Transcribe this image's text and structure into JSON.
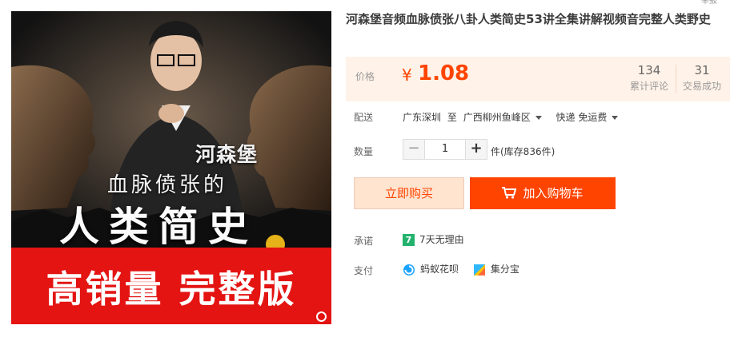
{
  "product_image": {
    "host": "河森堡",
    "subtitle": "血脉偾张的",
    "book_title": "人类简史",
    "banner": "高销量 完整版"
  },
  "product": {
    "title": "河森堡音频血脉偾张八卦人类简史53讲全集讲解视频音完整人类野史",
    "corner_cut_text": "举报"
  },
  "price": {
    "label": "价格",
    "currency": "¥",
    "amount": "1.08",
    "reviews_count": "134",
    "reviews_label": "累计评论",
    "sales_count": "31",
    "sales_label": "交易成功"
  },
  "delivery": {
    "label": "配送",
    "from": "广东深圳",
    "to_word": "至",
    "to": "广西柳州鱼峰区",
    "method": "快递 免运费"
  },
  "quantity": {
    "label": "数量",
    "minus": "−",
    "value": "1",
    "plus": "+",
    "stock": "件(库存836件)"
  },
  "actions": {
    "buy_now": "立即购买",
    "add_cart": "加入购物车"
  },
  "promise": {
    "label": "承诺",
    "icon_text": "7",
    "text": "7天无理由"
  },
  "payment": {
    "label": "支付",
    "methods": [
      "蚂蚁花呗",
      "集分宝"
    ]
  },
  "colors": {
    "accent": "#ff4400",
    "price_bg": "#fff2e8",
    "banner_red": "#e31412",
    "promise_green": "#23b26d"
  }
}
